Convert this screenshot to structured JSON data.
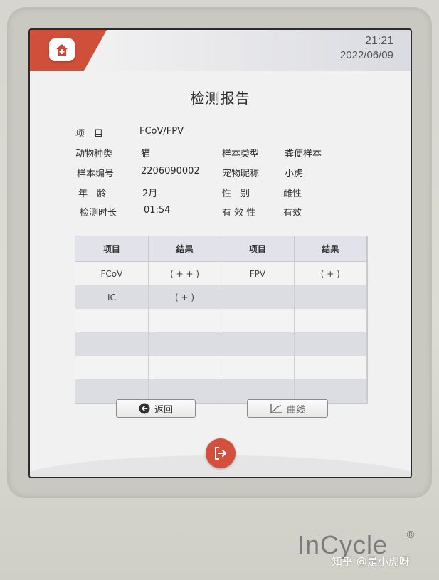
{
  "header": {
    "home_icon": "home-plus-icon",
    "time": "21:21",
    "date": "2022/06/09"
  },
  "report": {
    "title": "检测报告",
    "fields": {
      "item_label": "项　目",
      "item_value": "FCoV/FPV",
      "species_label": "动物种类",
      "species_value": "猫",
      "sample_type_label": "样本类型",
      "sample_type_value": "粪便样本",
      "sample_no_label": "样本编号",
      "sample_no_value": "2206090002",
      "pet_name_label": "宠物昵称",
      "pet_name_value": "小虎",
      "age_label": "年　龄",
      "age_value": "2月",
      "sex_label": "性　别",
      "sex_value": "雌性",
      "duration_label": "检测时长",
      "duration_value": "01:54",
      "validity_label": "有 效 性",
      "validity_value": "有效"
    },
    "table": {
      "headers": [
        "项目",
        "结果",
        "项目",
        "结果"
      ],
      "rows": [
        [
          "FCoV",
          "( + + )",
          "FPV",
          "( + )"
        ],
        [
          "IC",
          "( + )",
          "",
          ""
        ],
        [
          "",
          "",
          "",
          ""
        ],
        [
          "",
          "",
          "",
          ""
        ],
        [
          "",
          "",
          "",
          ""
        ],
        [
          "",
          "",
          "",
          ""
        ]
      ]
    }
  },
  "buttons": {
    "back_label": "返回",
    "curve_label": "曲线",
    "exit_icon": "exit-icon"
  },
  "device": {
    "brand": "InCycle",
    "registered": "®"
  },
  "watermark": "知乎 @是小虎呀",
  "colors": {
    "accent_red": "#d4503c",
    "header_band": "#e2e3ea"
  }
}
